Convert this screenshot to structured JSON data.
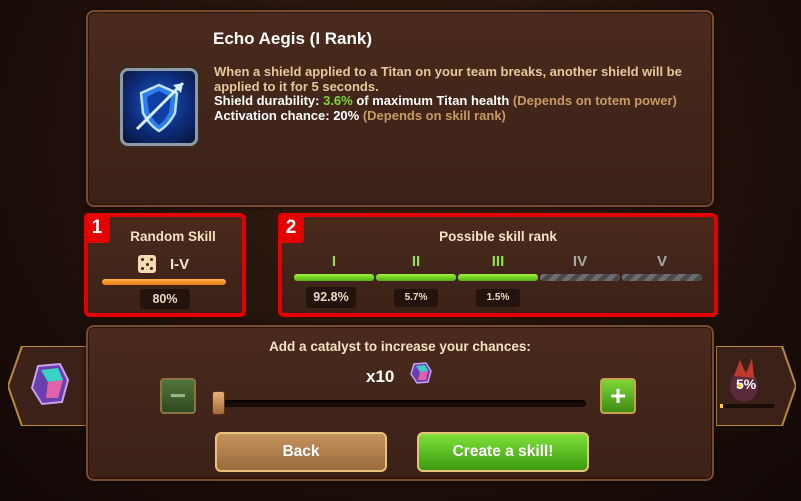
{
  "skill": {
    "title": "Echo Aegis (I Rank)",
    "description": "When a shield applied to a Titan on your team breaks, another shield will be applied to it for 5 seconds.",
    "durability_label": "Shield durability:",
    "durability_value": "3.6%",
    "durability_suffix": "of maximum Titan health",
    "durability_note": "(Depends on totem power)",
    "activation_label": "Activation chance: 20%",
    "activation_note": "(Depends on skill rank)",
    "icon": "shield-arrow-icon"
  },
  "random_skill": {
    "badge": "1",
    "title": "Random Skill",
    "range": "I-V",
    "chance": "80%",
    "icon": "dice-icon"
  },
  "possible_rank": {
    "badge": "2",
    "title": "Possible skill rank",
    "ranks": [
      {
        "label": "I",
        "chance": "92.8%",
        "active": true
      },
      {
        "label": "II",
        "chance": "5.7%",
        "active": true
      },
      {
        "label": "III",
        "chance": "1.5%",
        "active": true
      },
      {
        "label": "IV",
        "chance": "",
        "active": false
      },
      {
        "label": "V",
        "chance": "",
        "active": false
      }
    ]
  },
  "catalyst": {
    "title": "Add a catalyst to increase your chances:",
    "multiplier": "x10",
    "minus": "−",
    "plus": "+",
    "slider_fraction": 0
  },
  "buttons": {
    "back": "Back",
    "create": "Create a skill!"
  },
  "side": {
    "right_pct": "5%"
  },
  "colors": {
    "highlight": "#e50000",
    "green": "#7fd63a",
    "accent_text": "#e9c79a"
  }
}
